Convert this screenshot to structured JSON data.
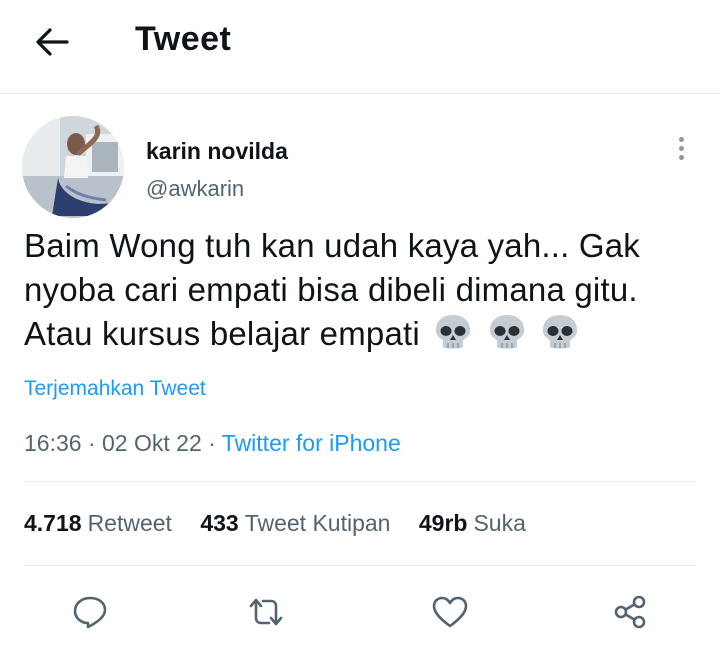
{
  "header": {
    "title": "Tweet"
  },
  "tweet": {
    "author": {
      "display_name": "karin novilda",
      "handle": "@awkarin"
    },
    "text": "Baim Wong tuh kan udah kaya yah... Gak nyoba cari empati bisa dibeli dimana gitu. Atau kursus belajar empati",
    "emojis": [
      "💀",
      "💀",
      "💀"
    ],
    "translate_label": "Terjemahkan Tweet",
    "time": "16:36",
    "date": "02 Okt 22",
    "separator": "·",
    "source": "Twitter for iPhone"
  },
  "stats": [
    {
      "count": "4.718",
      "label": "Retweet"
    },
    {
      "count": "433",
      "label": "Tweet Kutipan"
    },
    {
      "count": "49rb",
      "label": "Suka"
    }
  ],
  "colors": {
    "accent": "#1d9bf0",
    "text": "#0f1419",
    "secondary": "#536471",
    "divider": "#e6ecf0"
  },
  "icons": {
    "back": "arrow-left-icon",
    "more": "more-vertical-icon",
    "reply": "reply-icon",
    "retweet": "retweet-icon",
    "like": "heart-icon",
    "share": "share-icon",
    "emoji": "skull-emoji"
  }
}
